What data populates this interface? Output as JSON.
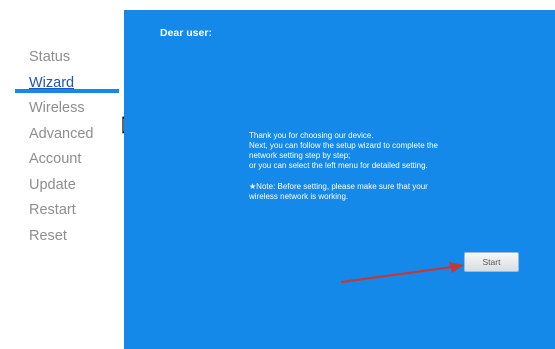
{
  "sidebar": {
    "items": [
      {
        "label": "Status"
      },
      {
        "label": "Wizard",
        "active": true
      },
      {
        "label": "Wireless"
      },
      {
        "label": "Advanced"
      },
      {
        "label": "Account"
      },
      {
        "label": "Update"
      },
      {
        "label": "Restart"
      },
      {
        "label": "Reset"
      }
    ]
  },
  "main": {
    "greeting": "Dear user:",
    "message_lines": [
      "Thank you for choosing our device.",
      "Next, you can follow the setup wizard to complete the",
      "network setting step by step;",
      "or you can select the left menu for detailed setting."
    ],
    "note_lines": [
      "★Note: Before setting, please make sure that your",
      "wireless network is working."
    ],
    "start_label": "Start"
  },
  "icons": {
    "cursor": "mouse-pointer-icon",
    "arrow": "red-arrow-annotation"
  },
  "colors": {
    "panel_bg": "#1489ea",
    "active_link": "#1f56b7",
    "menu_text": "#8e8e8e",
    "arrow": "#c0393b"
  }
}
